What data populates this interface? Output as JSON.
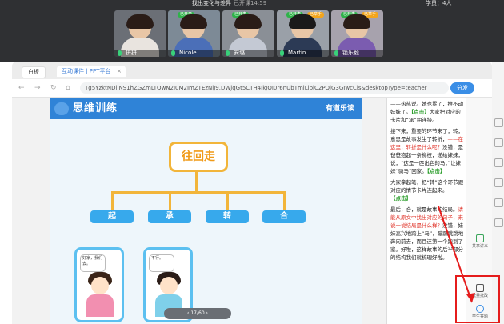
{
  "meeting": {
    "title": "找出变化与差异",
    "timer": "已开课14:59",
    "students": "学员：4人"
  },
  "participants": [
    {
      "name": "拼拼",
      "body_color": "#e9e4df",
      "hair_color": "#2a1c17"
    },
    {
      "name": "Nicole",
      "body_color": "#4b6fb8",
      "hair_color": "#2a1c17",
      "badge": "已开麦"
    },
    {
      "name": "安璐",
      "body_color": "#c4c9d4",
      "hair_color": "#2a1c17",
      "badge": "已开麦"
    },
    {
      "name": "Martin",
      "body_color": "#2c3a55",
      "hair_color": "#1a1a1a",
      "badge": "已开麦",
      "badge2": "已举手"
    },
    {
      "name": "锁乐毅",
      "body_color": "#7b5cb0",
      "hair_color": "#2a1c17",
      "badge": "已开麦",
      "badge2": "已举手"
    }
  ],
  "tabs": {
    "whiteboard": "白板",
    "ppt": "互动课件 | PPT平台",
    "close": "×"
  },
  "address": {
    "back": "←",
    "forward": "→",
    "refresh": "↻",
    "home": "⌂",
    "url": "Tg5YzktNDliNS1hZGZmLTQwN2I0M2ImZTEzNiJ9.DWjqGt5CTH4IkJOI0r6nUbTmiLlbiC2PQjG3GIwcCis&desktopType=teacher",
    "share": "分发"
  },
  "slide": {
    "title": "思维训练",
    "subtitle": "有道乐读",
    "topic": "往回走",
    "nodes": [
      "起",
      "承",
      "转",
      "合"
    ],
    "card1_bubble": "好家，我们去。",
    "card2_bubble": "不行。",
    "pager": "‹   17/60   ›"
  },
  "notes": {
    "p1": "——热热说。她也累了，推不动妹妹了。",
    "p1_tag": "【点击】",
    "p2": "大家把对应的卡片和“承”相连接。",
    "p3": "接下来，重要的环节来了，转，意思是故事发生了转折，",
    "p3_red": "——在这里，转折是什么呢？",
    "p4": "没错，是爸爸抱起一条柳枝，递给妹妹，说，“这是一匹出色的马，”让妹妹“骑马”回家。",
    "p4_tag": "【点击】",
    "p5": "大家拿起笔，把“转”这个环节跟对应的情节卡片连起来。",
    "p5_tag": "【点击】",
    "p6": "最后，合，就是故事的结局。",
    "p6_red": "请能从原文中找出对应的句子，来说一说结局是什么样？",
    "p7": "没错，妹妹高兴地跨上“马”，蹦蹦跳跳地奔向前去，而且还第一个跑到了家。",
    "p8": "好啦，这样故事的后半部分的结构我们就梳理好啦。"
  },
  "tools": {
    "share_notes": "共享讲义",
    "mark_answer": "批量批改",
    "submit": "学生答题"
  },
  "colors": {
    "topbar": "#2f3033",
    "header_blue": "#2f83d7",
    "node_blue": "#37a9ec",
    "topic_orange": "#f2b53a",
    "highlight_red": "#e51c1c"
  }
}
